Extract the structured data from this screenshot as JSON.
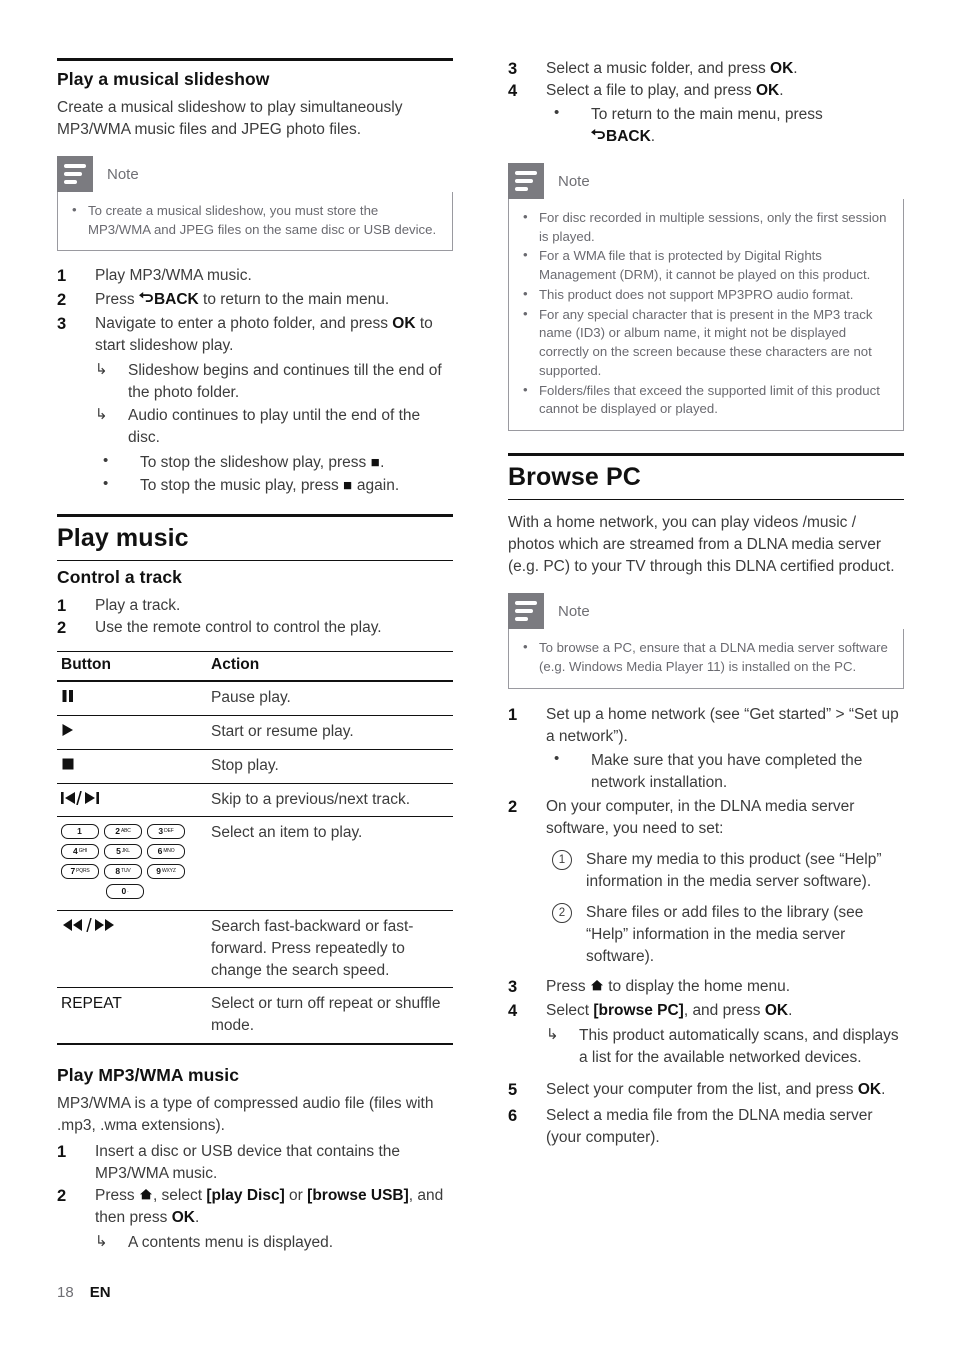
{
  "footer": {
    "page_number": "18",
    "language": "EN"
  },
  "icons": {
    "back": "back-arrow-icon",
    "home": "home-icon",
    "note": "note-icon"
  },
  "left_column": {
    "slideshow_section": {
      "heading": "Play a musical slideshow",
      "intro": "Create a musical slideshow to play simultaneously MP3/WMA music files and JPEG photo files.",
      "note": {
        "label": "Note",
        "items": [
          "To create a musical slideshow, you must store the MP3/WMA and JPEG files on the same disc or USB device."
        ]
      },
      "steps": [
        {
          "num": "1",
          "text": "Play MP3/WMA music."
        },
        {
          "num": "2",
          "text_before": "Press ",
          "bold": "BACK",
          "text_after": " to return to the main menu."
        },
        {
          "num": "3",
          "text_before": "Navigate to enter a photo folder, and press ",
          "bold": "OK",
          "text_after": " to start slideshow play."
        }
      ],
      "results": [
        "Slideshow begins and continues till the end of the photo folder.",
        "Audio continues to play until the end of the disc."
      ],
      "bullets": [
        {
          "before": "To stop the slideshow play, press ",
          "icon": "stop-icon",
          "after": "."
        },
        {
          "before": "To stop the music play, press ",
          "icon": "stop-icon",
          "after": " again."
        }
      ]
    },
    "play_music_section": {
      "heading": "Play music",
      "control_track": {
        "heading": "Control a track",
        "steps": [
          {
            "num": "1",
            "text": "Play a track."
          },
          {
            "num": "2",
            "text": "Use the remote control to control the play."
          }
        ]
      },
      "table": {
        "headers": [
          "Button",
          "Action"
        ],
        "rows": [
          {
            "button_icon": "pause-icon",
            "button_label": "",
            "action": "Pause play."
          },
          {
            "button_icon": "play-icon",
            "button_label": "",
            "action": "Start or resume play."
          },
          {
            "button_icon": "stop-icon",
            "button_label": "",
            "action": "Stop play."
          },
          {
            "button_icon": "skip-prev-next-icon",
            "button_label": "",
            "action": "Skip to a previous/next track."
          },
          {
            "button_icon": "numeric-keypad-icon",
            "button_label": "",
            "action": "Select an item to play."
          },
          {
            "button_icon": "fast-backward-forward-icon",
            "button_label": "",
            "action": "Search fast-backward or fast-forward. Press repeatedly to change the search speed."
          },
          {
            "button_icon": "",
            "button_label": "REPEAT",
            "action": "Select or turn off repeat or shuffle mode."
          }
        ]
      },
      "keypad": {
        "rows": [
          [
            {
              "digit": "1",
              "letters": ""
            },
            {
              "digit": "2",
              "letters": "ABC"
            },
            {
              "digit": "3",
              "letters": "DEF"
            }
          ],
          [
            {
              "digit": "4",
              "letters": "GHI"
            },
            {
              "digit": "5",
              "letters": "JKL"
            },
            {
              "digit": "6",
              "letters": "MNO"
            }
          ],
          [
            {
              "digit": "7",
              "letters": "PQRS"
            },
            {
              "digit": "8",
              "letters": "TUV"
            },
            {
              "digit": "9",
              "letters": "WXYZ"
            }
          ],
          [
            {
              "digit": "0",
              "letters": "."
            }
          ]
        ]
      },
      "mp3_section": {
        "heading": "Play MP3/WMA music",
        "intro": "MP3/WMA is a type of compressed audio file (files with .mp3, .wma extensions).",
        "steps": [
          {
            "num": "1",
            "text": "Insert a disc or USB device that contains the MP3/WMA music."
          },
          {
            "num": "2",
            "seg1": "Press ",
            "seg2": ", select ",
            "bold1": "[play Disc]",
            "seg3": " or ",
            "bold2": "[browse USB]",
            "seg4": ", and then press ",
            "bold3": "OK",
            "seg5": "."
          }
        ],
        "result": "A contents menu is displayed."
      }
    }
  },
  "right_column": {
    "continued_steps": [
      {
        "num": "3",
        "before": "Select a music folder, and press ",
        "bold": "OK",
        "after": "."
      },
      {
        "num": "4",
        "before": "Select a file to play, and press ",
        "bold": "OK",
        "after": "."
      }
    ],
    "continued_bullet": {
      "text": "To return to the main menu, press",
      "bold": "BACK",
      "after": "."
    },
    "note_top": {
      "label": "Note",
      "items": [
        "For disc recorded in multiple sessions, only the first session is played.",
        "For a WMA file that is protected by Digital Rights Management (DRM), it cannot be played on this product.",
        "This product does not support MP3PRO audio format.",
        "For any special character that is present in the MP3 track name (ID3) or album name, it might not be displayed correctly on the screen because these characters are not supported.",
        "Folders/files that exceed the supported limit of this product cannot be displayed or played."
      ]
    },
    "browse_pc": {
      "heading": "Browse PC",
      "intro": "With a home network, you can play videos /music / photos which are streamed from a DLNA media server (e.g. PC) to your TV through this DLNA certified product.",
      "note": {
        "label": "Note",
        "items": [
          "To browse a PC, ensure that a DLNA media server software (e.g. Windows Media Player 11) is installed on the PC."
        ]
      },
      "step1": {
        "num": "1",
        "text": "Set up a home network (see “Get started” > “Set up a network”)."
      },
      "step1_bullet": "Make sure that you have completed the network installation.",
      "step2": {
        "num": "2",
        "text": "On your computer, in the DLNA media server software, you need to set:"
      },
      "step2_substeps": [
        {
          "num": "1",
          "text": "Share my media to this product (see “Help” information in the media server software)."
        },
        {
          "num": "2",
          "text": "Share files or add files to the library (see “Help” information in the media server software)."
        }
      ],
      "step3": {
        "num": "3",
        "before": "Press ",
        "after": " to display the home menu."
      },
      "step4": {
        "num": "4",
        "before": "Select ",
        "bold1": "[browse PC]",
        "mid": ", and press ",
        "bold2": "OK",
        "after": "."
      },
      "step4_result": "This product automatically scans, and displays a list for the available networked devices.",
      "step5": {
        "num": "5",
        "before": "Select your computer from the list, and press ",
        "bold": "OK",
        "after": "."
      },
      "step6": {
        "num": "6",
        "text": "Select a media file from the DLNA media server (your computer)."
      }
    }
  }
}
